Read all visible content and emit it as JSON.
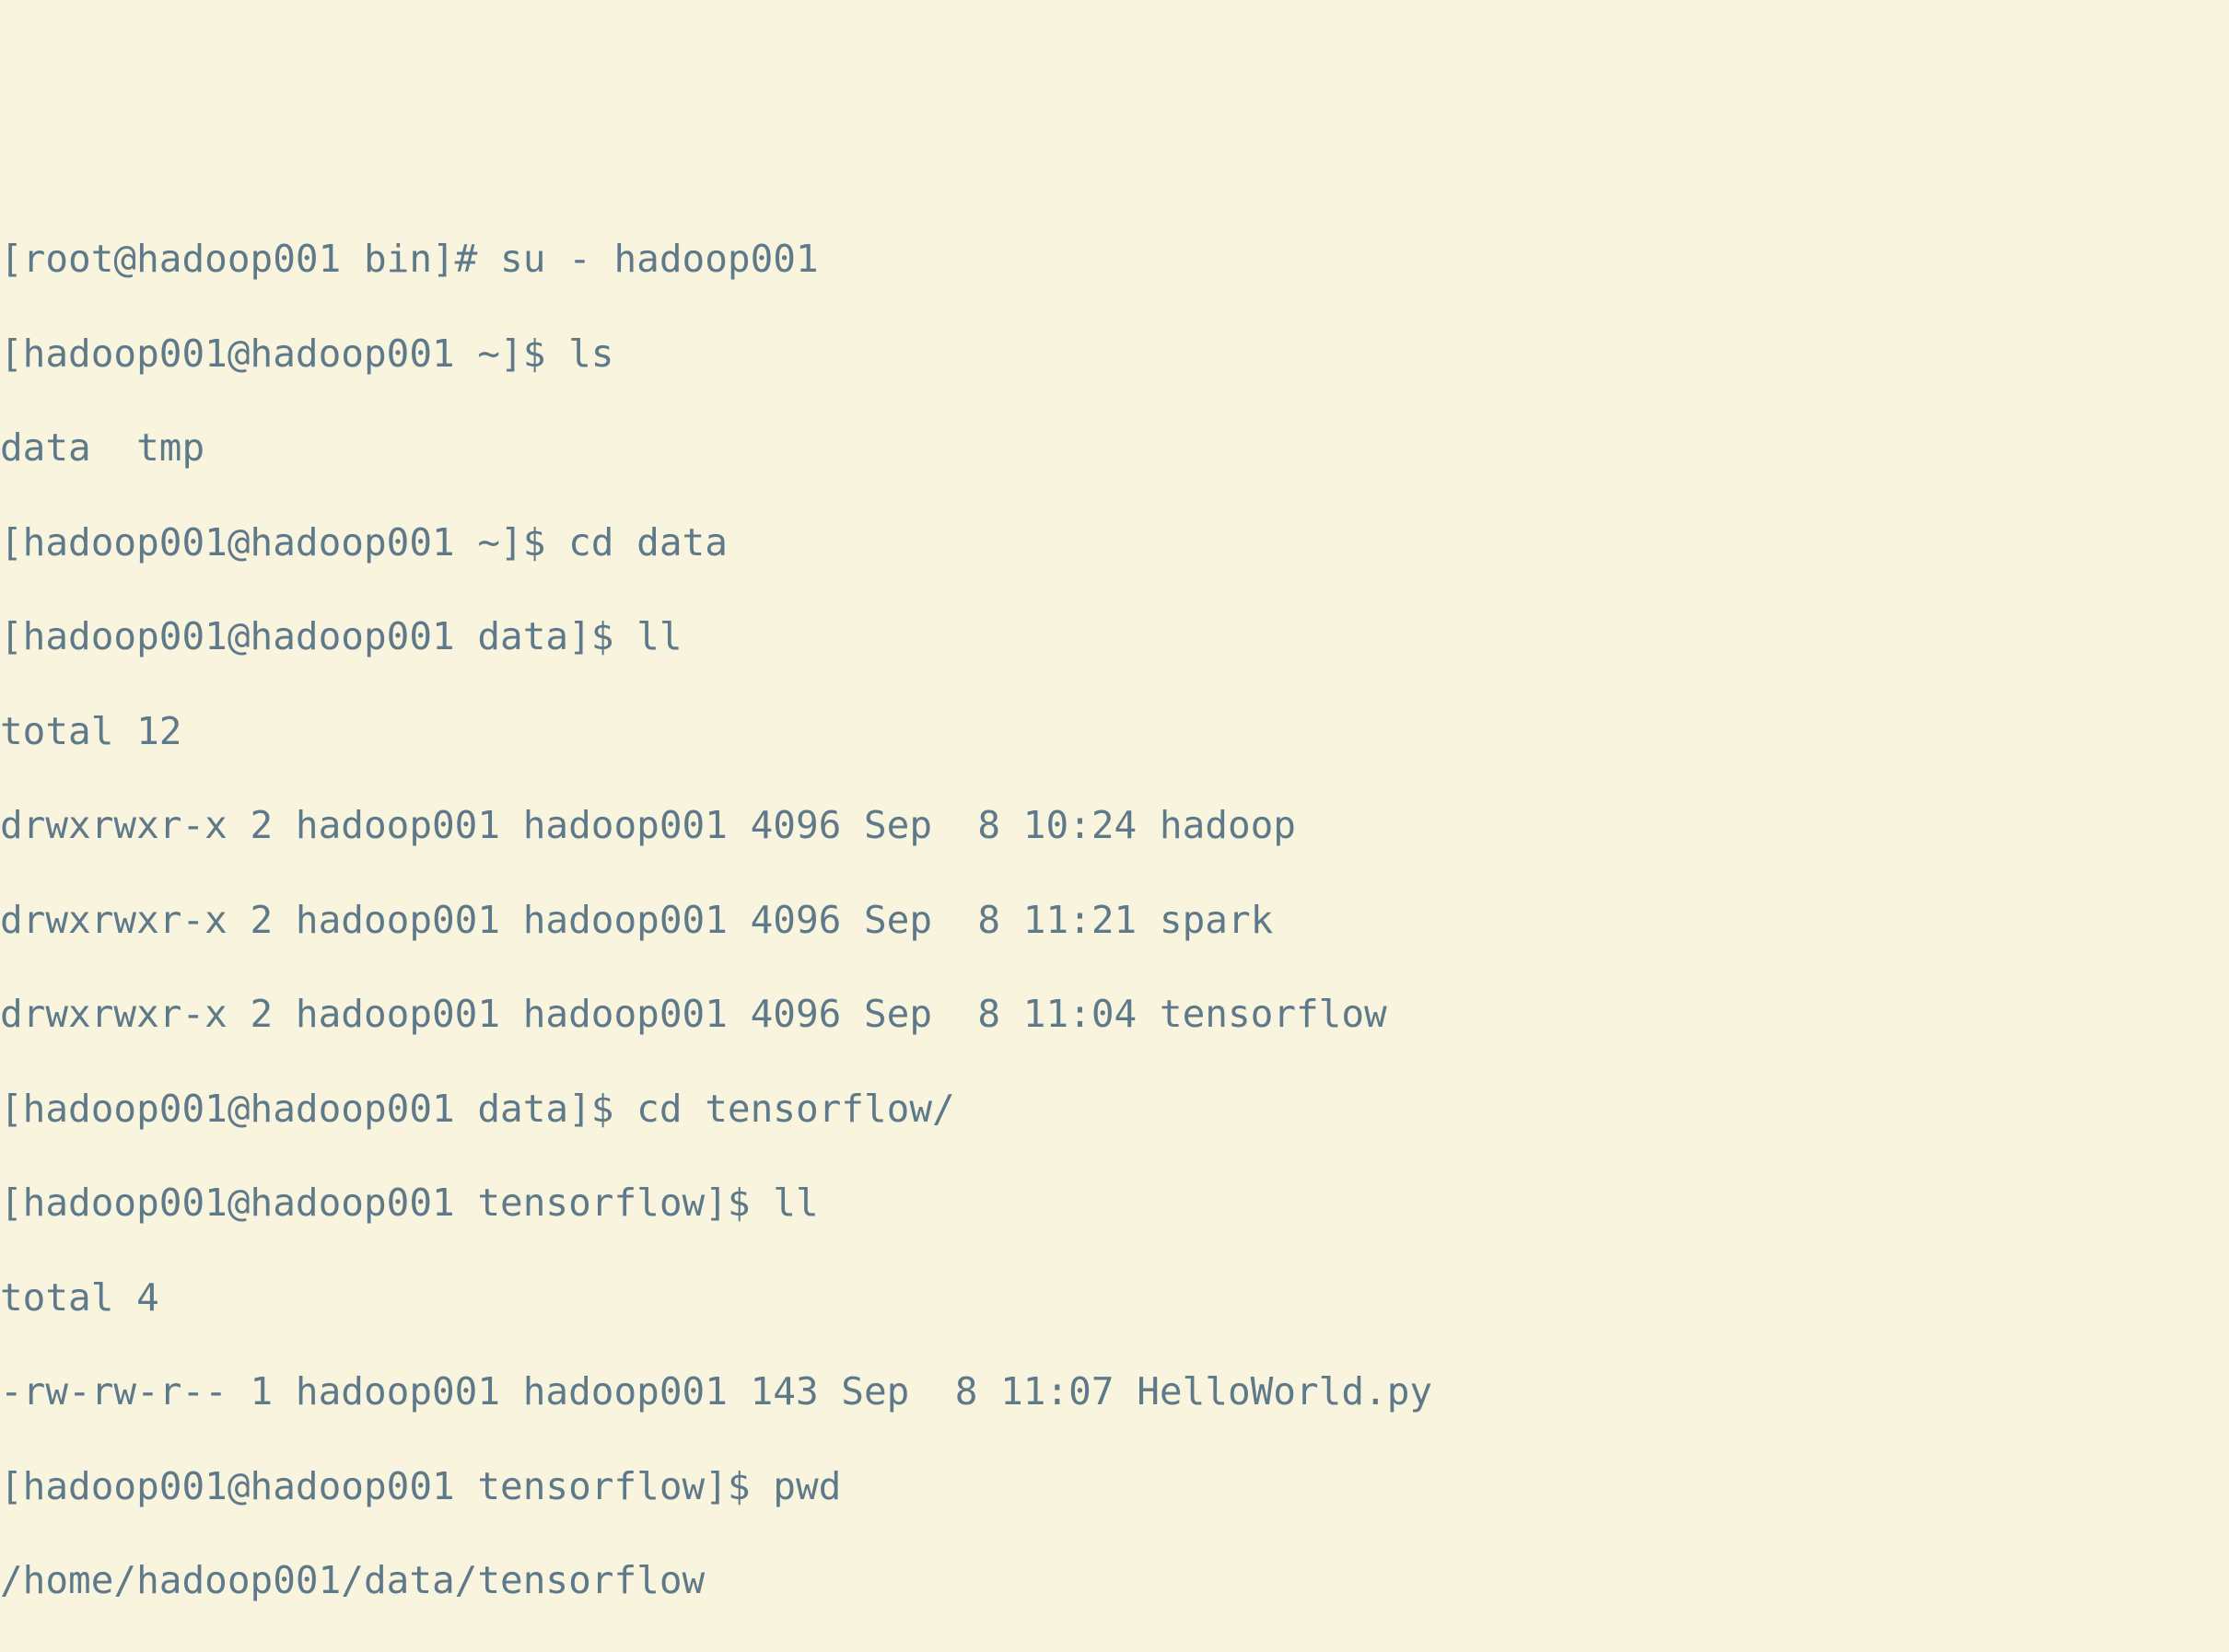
{
  "lines": {
    "l1": "[root@hadoop001 bin]# su - hadoop001",
    "l2": "[hadoop001@hadoop001 ~]$ ls",
    "l3": "data  tmp",
    "l4": "[hadoop001@hadoop001 ~]$ cd data",
    "l5": "[hadoop001@hadoop001 data]$ ll",
    "l6": "total 12",
    "l7": "drwxrwxr-x 2 hadoop001 hadoop001 4096 Sep  8 10:24 hadoop",
    "l8": "drwxrwxr-x 2 hadoop001 hadoop001 4096 Sep  8 11:21 spark",
    "l9": "drwxrwxr-x 2 hadoop001 hadoop001 4096 Sep  8 11:04 tensorflow",
    "l10": "[hadoop001@hadoop001 data]$ cd tensorflow/",
    "l11": "[hadoop001@hadoop001 tensorflow]$ ll",
    "l12": "total 4",
    "l13": "-rw-rw-r-- 1 hadoop001 hadoop001 143 Sep  8 11:07 HelloWorld.py",
    "l14": "[hadoop001@hadoop001 tensorflow]$ pwd",
    "l15": "/home/hadoop001/data/tensorflow"
  }
}
